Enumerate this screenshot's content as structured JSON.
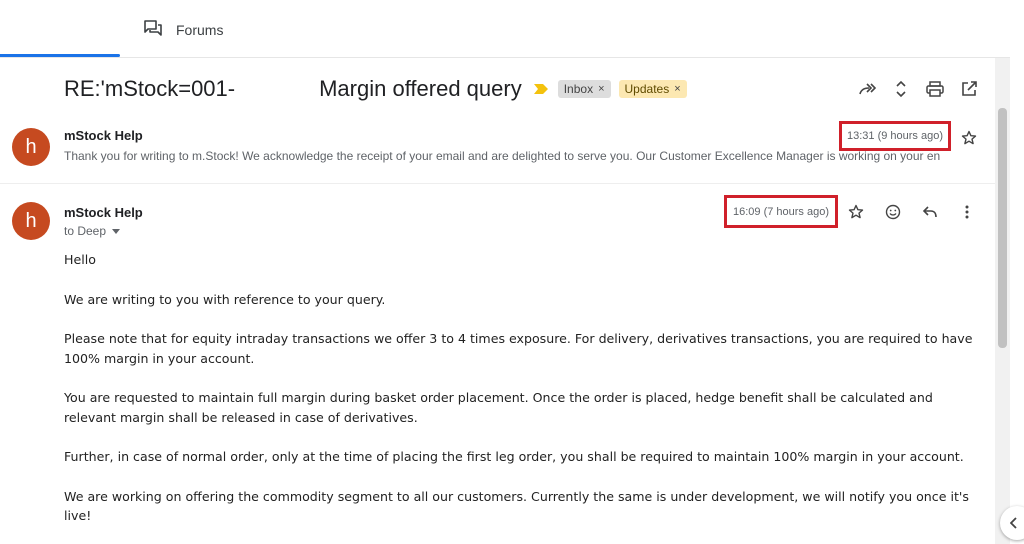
{
  "tabs": {
    "forums_label": "Forums"
  },
  "subject": {
    "prefix": "RE:'mStock=001-",
    "suffix": "Margin offered query",
    "labels": [
      {
        "name": "Inbox",
        "remove": "×",
        "color": "#dddddd"
      },
      {
        "name": "Updates",
        "remove": "×",
        "color": "#fce8b2"
      }
    ]
  },
  "toolbar_icons": [
    "forward-all-icon",
    "expand-collapse-icon",
    "print-icon",
    "open-in-new-window-icon"
  ],
  "messages": [
    {
      "avatar_letter": "h",
      "avatar_color": "#c64a20",
      "sender": "mStock Help",
      "time": "13:31 (9 hours ago)",
      "snippet": "Thank you for writing to m.Stock! We acknowledge the receipt of your email and are delighted to serve you. Our Customer Excellence Manager is working on your en"
    },
    {
      "avatar_letter": "h",
      "avatar_color": "#c64a20",
      "sender": "mStock Help",
      "to": "to Deep",
      "time": "16:09 (7 hours ago)",
      "body": [
        "Hello",
        "We are writing to you with reference to your query.",
        "Please note that for equity intraday transactions we offer 3 to 4 times exposure. For delivery, derivatives transactions, you are required to have 100% margin in your account.",
        "You are requested to maintain full margin during basket order placement. Once the order is placed, hedge benefit shall be calculated and relevant margin shall be released in case of derivatives.",
        "Further, in case of normal order, only at the time of placing the first leg order, you shall be required to maintain 100% margin in your account.",
        "We are working on offering the commodity segment to all our customers. Currently the same is under development, we will notify you once it's live!"
      ]
    }
  ],
  "highlight_color": "#d0202a"
}
